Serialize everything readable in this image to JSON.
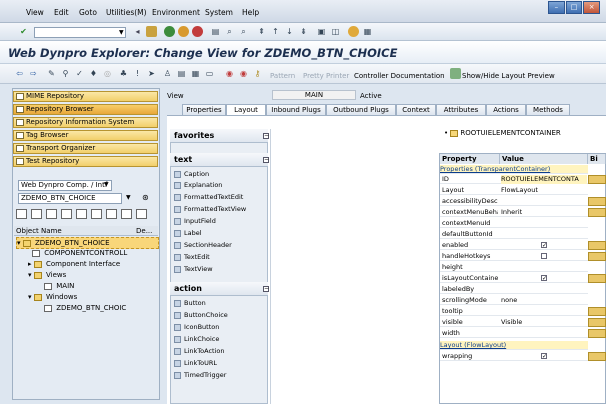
{
  "menu": [
    "View",
    "Edit",
    "Goto",
    "Utilities(M)",
    "Environment",
    "System",
    "Help"
  ],
  "title": "Web Dynpro Explorer: Change View for ZDEMO_BTN_CHOICE",
  "toolbar": {
    "pattern": "Pattern",
    "pretty_printer": "Pretty Printer",
    "controller_doc": "Controller Documentation",
    "show_hide": "Show/Hide Layout Preview"
  },
  "nav": [
    "MIME Repository",
    "Repository Browser",
    "Repository Information System",
    "Tag Browser",
    "Transport Organizer",
    "Test Repository"
  ],
  "object_type": "Web Dynpro Comp. / Intf",
  "object_name": "ZDEMO_BTN_CHOICE",
  "tree": {
    "col_object": "Object Name",
    "col_desc": "De...",
    "items": [
      "ZDEMO_BTN_CHOICE",
      "COMPONENTCONTROLL",
      "Component Interface",
      "Views",
      "MAIN",
      "Windows",
      "ZDEMO_BTN_CHOIC"
    ]
  },
  "view": {
    "label": "View",
    "value": "MAIN",
    "status": "Active"
  },
  "tabs": [
    "Properties",
    "Layout",
    "Inbound Plugs",
    "Outbound Plugs",
    "Context",
    "Attributes",
    "Actions",
    "Methods"
  ],
  "palette": {
    "favorites": "favorites",
    "text": "text",
    "text_items": [
      "Caption",
      "Explanation",
      "FormattedTextEdit",
      "FormattedTextView",
      "InputField",
      "Label",
      "SectionHeader",
      "TextEdit",
      "TextView"
    ],
    "action": "action",
    "action_items": [
      "Button",
      "ButtonChoice",
      "IconButton",
      "LinkChoice",
      "LinkToAction",
      "LinkToURL",
      "TimedTrigger"
    ]
  },
  "root": "ROOTUIELEMENTCONTAINER",
  "props": {
    "h_property": "Property",
    "h_value": "Value",
    "h_b": "Bi",
    "sec1": "Properties (TransparentContainer)",
    "rows": [
      {
        "n": "ID",
        "v": "ROOTUIELEMENTCONTA"
      },
      {
        "n": "Layout",
        "v": "FlowLayout"
      },
      {
        "n": "accessibilityDesc",
        "v": ""
      },
      {
        "n": "contextMenuBeha",
        "v": "Inherit"
      },
      {
        "n": "contextMenuId",
        "v": ""
      },
      {
        "n": "defaultButtonId",
        "v": ""
      },
      {
        "n": "enabled",
        "v": "✓"
      },
      {
        "n": "handleHotkeys",
        "v": ""
      },
      {
        "n": "height",
        "v": ""
      },
      {
        "n": "isLayoutContaine",
        "v": "✓"
      },
      {
        "n": "labeledBy",
        "v": ""
      },
      {
        "n": "scrollingMode",
        "v": "none"
      },
      {
        "n": "tooltip",
        "v": ""
      },
      {
        "n": "visible",
        "v": "Visible"
      },
      {
        "n": "width",
        "v": ""
      }
    ],
    "sec2": "Layout (FlowLayout)",
    "wrap_n": "wrapping",
    "wrap_v": "✓"
  }
}
